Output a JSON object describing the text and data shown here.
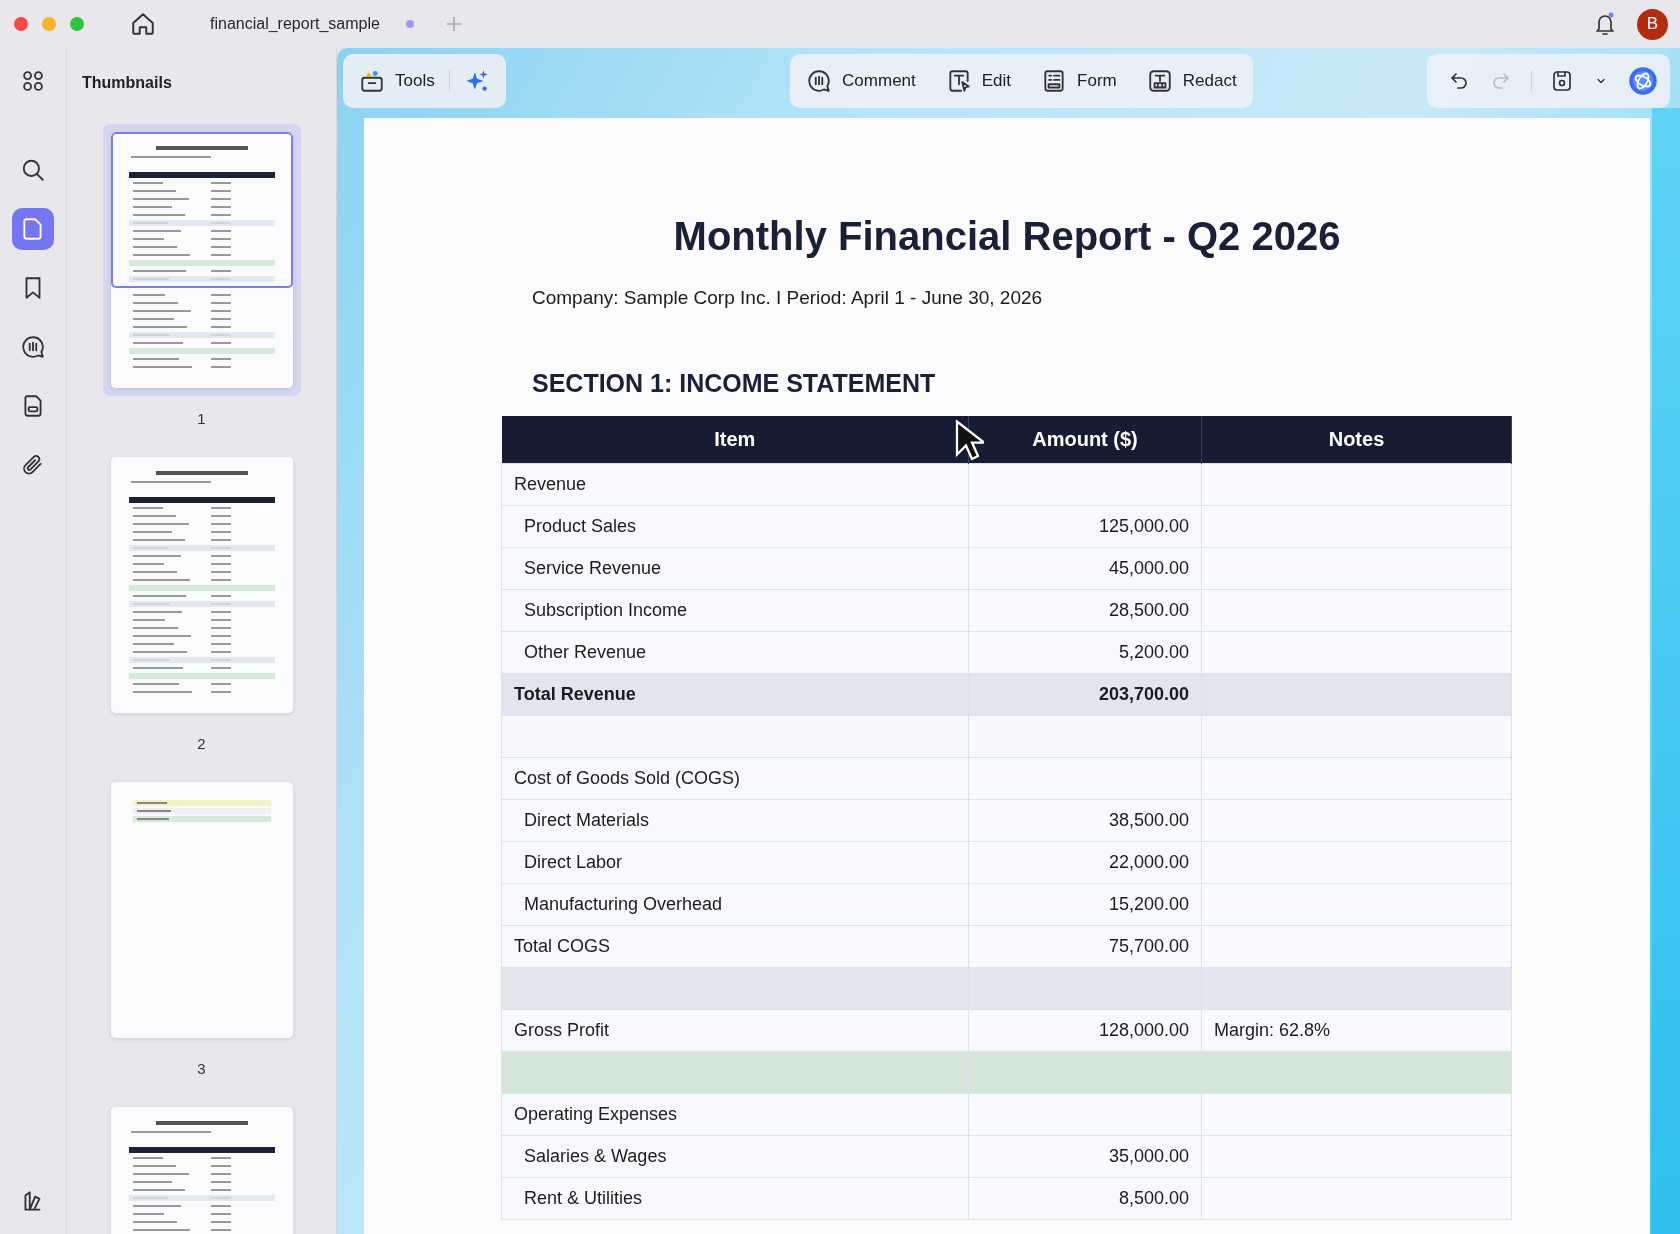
{
  "title_bar": {
    "tab_title": "financial_report_sample",
    "tab_unsaved": true,
    "avatar_letter": "B",
    "notification": true
  },
  "rail": [
    {
      "kind": "grid",
      "selected": false
    },
    {
      "kind": "search",
      "selected": false
    },
    {
      "kind": "page",
      "selected": true
    },
    {
      "kind": "bookmark",
      "selected": false
    },
    {
      "kind": "comment",
      "selected": false
    },
    {
      "kind": "document",
      "selected": false
    },
    {
      "kind": "clip",
      "selected": false
    }
  ],
  "thumbnails": {
    "title": "Thumbnails",
    "pages": [
      {
        "label": "1",
        "selected": true,
        "kind": "full"
      },
      {
        "label": "2",
        "selected": false,
        "kind": "full"
      },
      {
        "label": "3",
        "selected": false,
        "kind": "short"
      },
      {
        "selected": false,
        "kind": "full"
      }
    ]
  },
  "toolbar": {
    "left": [
      {
        "label": "Tools",
        "kind": "tools"
      },
      {
        "kind": "sparkle"
      }
    ],
    "center": [
      {
        "label": "Comment",
        "kind": "comment"
      },
      {
        "label": "Edit",
        "kind": "edit"
      },
      {
        "label": "Form",
        "kind": "form"
      },
      {
        "label": "Redact",
        "kind": "redact"
      }
    ],
    "right": [
      {
        "kind": "undo",
        "disabled": false
      },
      {
        "kind": "redo",
        "disabled": true
      },
      {
        "kind": "save",
        "disabled": false
      },
      {
        "kind": "chevron",
        "disabled": false
      },
      {
        "kind": "orb",
        "disabled": false
      }
    ]
  },
  "document": {
    "title": "Monthly Financial Report - Q2 2026",
    "subtitle": "Company: Sample Corp Inc. I Period: April 1 - June 30, 2026",
    "section": "SECTION 1: INCOME STATEMENT",
    "table": {
      "columns": [
        "Item",
        "Amount ($)",
        "Notes"
      ],
      "rows": [
        {
          "kind": "group",
          "item": "Revenue",
          "children": [
            {
              "item": "Product Sales",
              "amount": "125,000.00"
            },
            {
              "item": "Service Revenue",
              "amount": "45,000.00"
            },
            {
              "item": "Subscription Income",
              "amount": "28,500.00"
            },
            {
              "item": "Other Revenue",
              "amount": "5,200.00"
            }
          ]
        },
        {
          "kind": "total",
          "item": "Total Revenue",
          "amount": "203,700.00"
        },
        {
          "kind": "spacer",
          "color": "#f7f8fc"
        },
        {
          "kind": "group",
          "item": "Cost of Goods Sold (COGS)",
          "children": [
            {
              "item": "Direct Materials",
              "amount": "38,500.00"
            },
            {
              "item": "Direct Labor",
              "amount": "22,000.00"
            },
            {
              "item": "Manufacturing Overhead",
              "amount": "15,200.00"
            }
          ]
        },
        {
          "kind": "line",
          "item": "Total COGS",
          "amount": "75,700.00"
        },
        {
          "kind": "spacer",
          "color": "#e4e6ee"
        },
        {
          "kind": "line",
          "item": "Gross Profit",
          "amount": "128,000.00",
          "notes": "Margin: 62.8%"
        },
        {
          "kind": "spacer",
          "color": "#d4e6d6"
        },
        {
          "kind": "group",
          "item": "Operating Expenses",
          "children": [
            {
              "item": "Salaries & Wages",
              "amount": "35,000.00"
            },
            {
              "item": "Rent & Utilities",
              "amount": "8,500.00"
            }
          ]
        }
      ]
    }
  }
}
